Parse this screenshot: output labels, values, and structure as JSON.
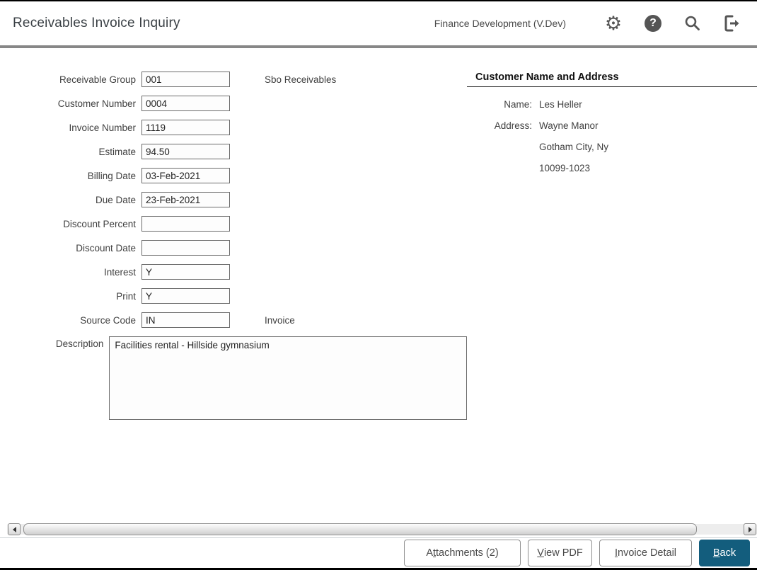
{
  "header": {
    "title": "Receivables Invoice Inquiry",
    "environment": "Finance Development (V.Dev)",
    "help_glyph": "?"
  },
  "colors": {
    "accent": "#135d7d",
    "icon_gray": "#555555",
    "rule_gray": "#878787"
  },
  "form": {
    "fields": [
      {
        "label": "Receivable Group",
        "value": "001",
        "note": "Sbo Receivables"
      },
      {
        "label": "Customer Number",
        "value": "0004"
      },
      {
        "label": "Invoice Number",
        "value": "1119"
      },
      {
        "label": "Estimate",
        "value": "94.50"
      },
      {
        "label": "Billing Date",
        "value": "03-Feb-2021"
      },
      {
        "label": "Due Date",
        "value": "23-Feb-2021"
      },
      {
        "label": "Discount Percent",
        "value": ""
      },
      {
        "label": "Discount Date",
        "value": ""
      },
      {
        "label": "Interest",
        "value": "Y"
      },
      {
        "label": "Print",
        "value": "Y"
      },
      {
        "label": "Source Code",
        "value": "IN",
        "note": "Invoice"
      }
    ],
    "description": {
      "label": "Description",
      "value": "Facilities rental - Hillside gymnasium"
    }
  },
  "customer": {
    "title": "Customer Name and Address",
    "name_label": "Name:",
    "name_value": "Les Heller",
    "address_label": "Address:",
    "address_lines": [
      "Wayne Manor",
      "Gotham City, Ny",
      "10099-1023"
    ]
  },
  "footer": {
    "buttons": {
      "attachments": {
        "pre": "A",
        "key": "t",
        "post": "tachments (2)"
      },
      "view_pdf": {
        "pre": "",
        "key": "V",
        "post": "iew PDF"
      },
      "invoice_detail": {
        "pre": "",
        "key": "I",
        "post": "nvoice Detail"
      },
      "back": {
        "pre": "",
        "key": "B",
        "post": "ack"
      }
    }
  }
}
